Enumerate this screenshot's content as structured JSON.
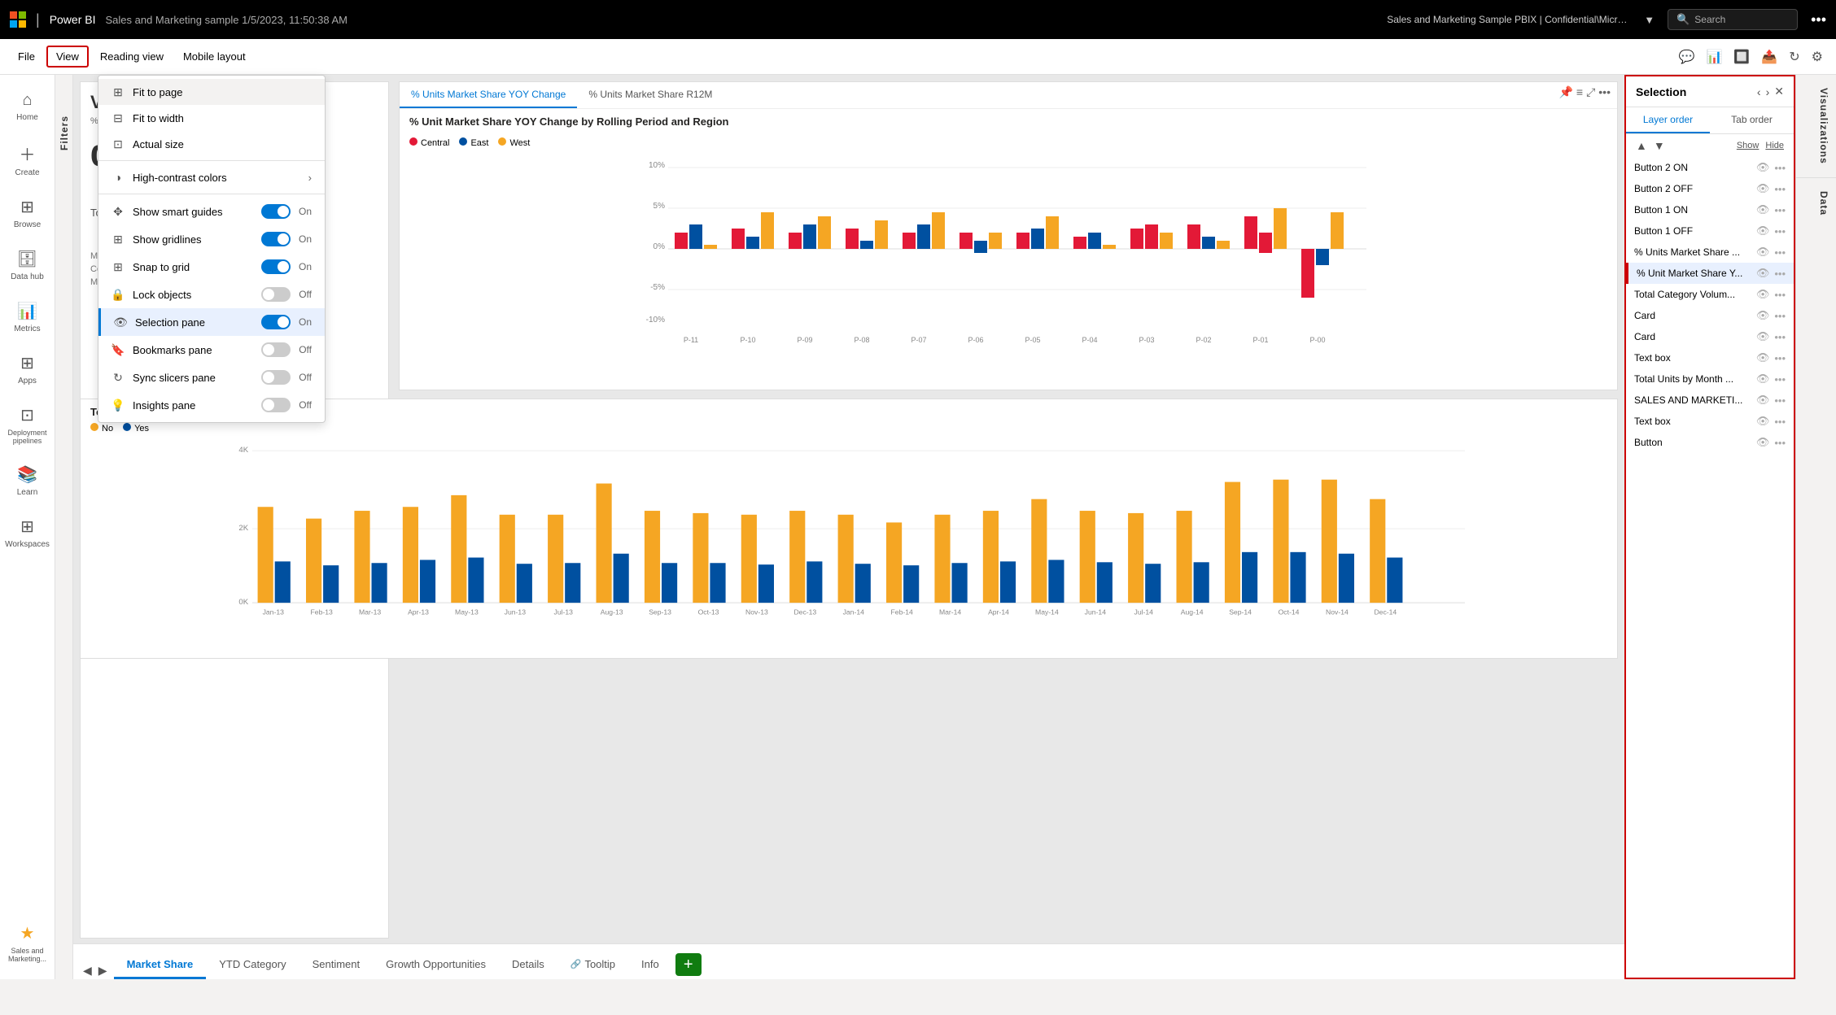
{
  "app": {
    "title": "Power BI",
    "doc_title": "Sales and Marketing sample 1/5/2023, 11:50:38 AM",
    "file_info": "Sales and Marketing Sample PBIX | Confidential\\Microsoft ...",
    "search_placeholder": "Search"
  },
  "toolbar": {
    "file_label": "File",
    "view_label": "View",
    "reading_view_label": "Reading view",
    "mobile_layout_label": "Mobile layout"
  },
  "view_menu": {
    "items": [
      {
        "id": "fit_page",
        "label": "Fit to page",
        "icon": "⊞",
        "type": "option",
        "active": false
      },
      {
        "id": "fit_width",
        "label": "Fit to width",
        "icon": "⊟",
        "type": "option",
        "active": false
      },
      {
        "id": "actual_size",
        "label": "Actual size",
        "icon": "⊡",
        "type": "option",
        "active": false
      },
      {
        "id": "high_contrast",
        "label": "High-contrast colors",
        "icon": "◑",
        "type": "submenu",
        "active": false
      },
      {
        "id": "smart_guides",
        "label": "Show smart guides",
        "icon": "✥",
        "type": "toggle",
        "value": "On",
        "on": true
      },
      {
        "id": "gridlines",
        "label": "Show gridlines",
        "icon": "⊞",
        "type": "toggle",
        "value": "On",
        "on": true
      },
      {
        "id": "snap_grid",
        "label": "Snap to grid",
        "icon": "⊞",
        "type": "toggle",
        "value": "On",
        "on": true
      },
      {
        "id": "lock_objects",
        "label": "Lock objects",
        "icon": "🔒",
        "type": "toggle",
        "value": "Off",
        "on": false
      },
      {
        "id": "selection_pane",
        "label": "Selection pane",
        "icon": "👁",
        "type": "toggle",
        "value": "On",
        "on": true,
        "active": true
      },
      {
        "id": "bookmarks",
        "label": "Bookmarks pane",
        "icon": "🔖",
        "type": "toggle",
        "value": "Off",
        "on": false
      },
      {
        "id": "sync_slicers",
        "label": "Sync slicers pane",
        "icon": "↻",
        "type": "toggle",
        "value": "Off",
        "on": false
      },
      {
        "id": "insights",
        "label": "Insights pane",
        "icon": "💡",
        "type": "toggle",
        "value": "Off",
        "on": false
      }
    ]
  },
  "sidebar": {
    "items": [
      {
        "id": "home",
        "label": "Home",
        "icon": "⌂"
      },
      {
        "id": "create",
        "label": "Create",
        "icon": "+"
      },
      {
        "id": "browse",
        "label": "Browse",
        "icon": "⊞"
      },
      {
        "id": "datahub",
        "label": "Data hub",
        "icon": "🗄"
      },
      {
        "id": "metrics",
        "label": "Metrics",
        "icon": "📊"
      },
      {
        "id": "apps",
        "label": "Apps",
        "icon": "⊞",
        "active": false
      },
      {
        "id": "deployment",
        "label": "Deployment pipelines",
        "icon": "⊡"
      },
      {
        "id": "learn",
        "label": "Learn",
        "icon": "📚"
      },
      {
        "id": "workspaces",
        "label": "Workspaces",
        "icon": "⊞"
      },
      {
        "id": "salesmarketing",
        "label": "Sales and Marketing...",
        "icon": "★",
        "bottom": true
      }
    ]
  },
  "selection_pane": {
    "title": "Selection",
    "tabs": [
      {
        "id": "layer_order",
        "label": "Layer order",
        "active": true
      },
      {
        "id": "tab_order",
        "label": "Tab order",
        "active": false
      }
    ],
    "show_label": "Show",
    "hide_label": "Hide",
    "items": [
      {
        "id": "btn2on",
        "name": "Button 2 ON",
        "highlighted": false
      },
      {
        "id": "btn2off",
        "name": "Button 2 OFF",
        "highlighted": false
      },
      {
        "id": "btn1on",
        "name": "Button 1 ON",
        "highlighted": false
      },
      {
        "id": "btn1off",
        "name": "Button 1 OFF",
        "highlighted": false
      },
      {
        "id": "units_market_share",
        "name": "% Units Market Share ...",
        "highlighted": false
      },
      {
        "id": "unit_market_share_y",
        "name": "% Unit Market Share Y...",
        "highlighted": true
      },
      {
        "id": "total_category_vol",
        "name": "Total Category Volum...",
        "highlighted": false
      },
      {
        "id": "card1",
        "name": "Card",
        "highlighted": false
      },
      {
        "id": "card2",
        "name": "Card",
        "highlighted": false
      },
      {
        "id": "textbox1",
        "name": "Text box",
        "highlighted": false
      },
      {
        "id": "total_units_month",
        "name": "Total Units by Month ...",
        "highlighted": false
      },
      {
        "id": "sales_marketing",
        "name": "SALES AND MARKETI...",
        "highlighted": false
      },
      {
        "id": "textbox2",
        "name": "Text box",
        "highlighted": false
      },
      {
        "id": "button",
        "name": "Button",
        "highlighted": false
      }
    ]
  },
  "right_panels": {
    "filters_label": "Filters",
    "visualizations_label": "Visualizations",
    "data_label": "Data"
  },
  "chart_top": {
    "tab1_label": "% Units Market Share YOY Change",
    "tab2_label": "% Units Market Share R12M",
    "title": "% Unit Market Share YOY Change by Rolling Period and Region",
    "legend": [
      {
        "color": "#E31937",
        "label": "Central"
      },
      {
        "color": "#0050A0",
        "label": "East"
      },
      {
        "color": "#F5A623",
        "label": "West"
      }
    ],
    "y_labels": [
      "10%",
      "5%",
      "0%",
      "-5%",
      "-10%"
    ],
    "x_labels": [
      "P-11",
      "P-10",
      "P-09",
      "P-08",
      "P-07",
      "P-06",
      "P-05",
      "P-04",
      "P-03",
      "P-02",
      "P-01",
      "P-00"
    ]
  },
  "chart_bottom": {
    "title": "Total Units by Month and isVanArsdel",
    "legend": [
      {
        "color": "#F5A623",
        "label": "No"
      },
      {
        "color": "#0050A0",
        "label": "Yes"
      }
    ],
    "y_labels": [
      "4K",
      "2K",
      "0K"
    ],
    "x_labels": [
      "Jan-13",
      "Feb-13",
      "Mar-13",
      "Apr-13",
      "May-13",
      "Jun-13",
      "Jul-13",
      "Aug-13",
      "Sep-13",
      "Oct-13",
      "Nov-13",
      "Dec-13",
      "Jan-14",
      "Feb-14",
      "Mar-14",
      "Apr-14",
      "May-14",
      "Jun-14",
      "Jul-14",
      "Aug-14",
      "Sep-14",
      "Oct-14",
      "Nov-14",
      "Dec-14"
    ]
  },
  "bottom_tabs": {
    "tabs": [
      {
        "id": "market_share",
        "label": "Market Share",
        "active": true
      },
      {
        "id": "ytd_category",
        "label": "YTD Category",
        "active": false
      },
      {
        "id": "sentiment",
        "label": "Sentiment",
        "active": false
      },
      {
        "id": "growth_opp",
        "label": "Growth Opportunities",
        "active": false
      },
      {
        "id": "details",
        "label": "Details",
        "active": false
      },
      {
        "id": "tooltip",
        "label": "Tooltip",
        "active": false,
        "has_icon": true
      },
      {
        "id": "info",
        "label": "Info",
        "active": false
      }
    ],
    "add_label": "+"
  },
  "left_chart": {
    "title": "Va...",
    "subtitle": "% Units Market Share",
    "segment_labels": [
      "Moderation",
      "Convenience"
    ],
    "total_units_label": "Total Units by Month"
  },
  "colors": {
    "accent": "#0078d4",
    "red": "#E31937",
    "blue": "#0050A0",
    "yellow": "#F5A623",
    "green": "#107c10",
    "selection_border": "#cc0000"
  }
}
